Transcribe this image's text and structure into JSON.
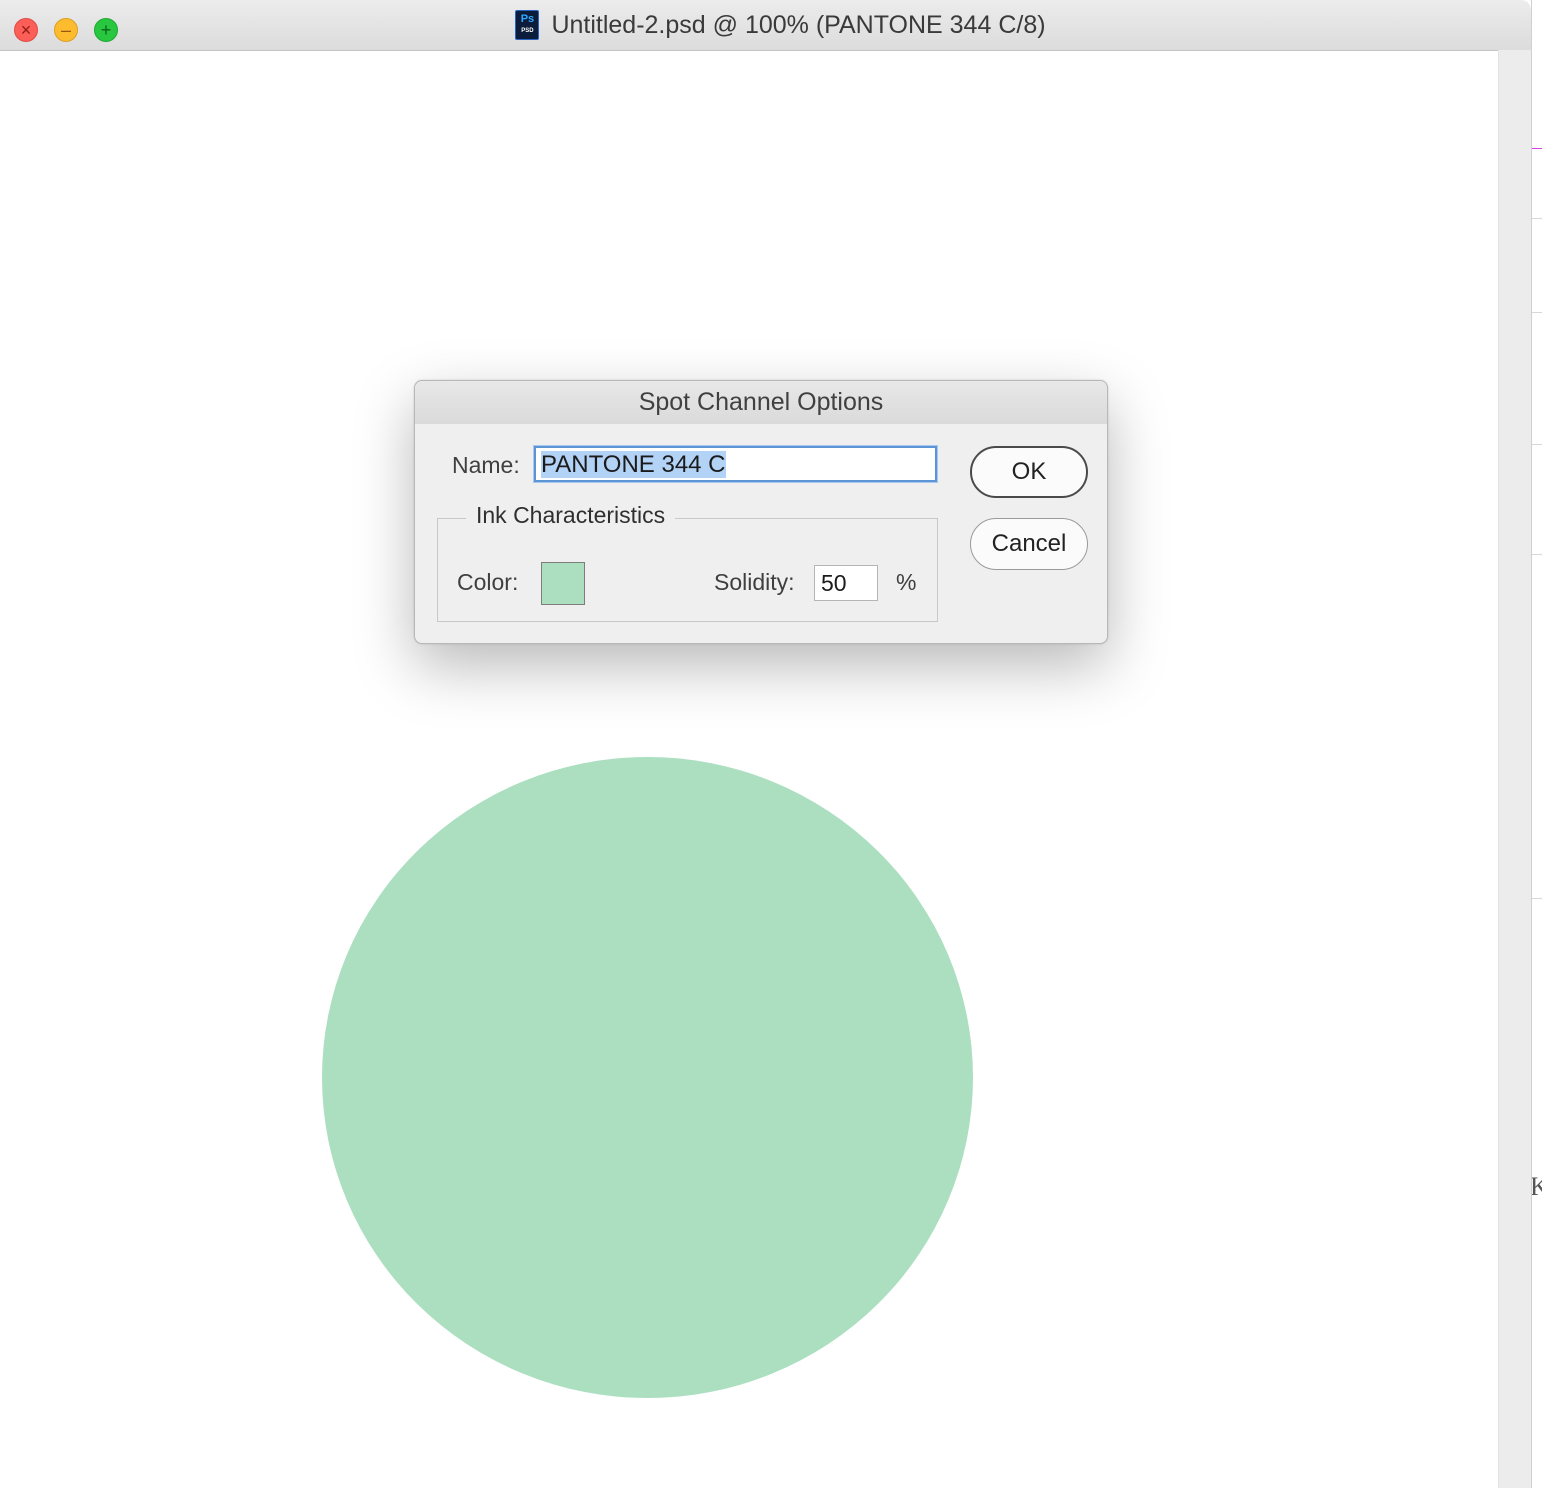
{
  "window": {
    "title": "Untitled-2.psd @ 100% (PANTONE 344 C/8)",
    "doc_icon_text": "Ps",
    "doc_icon_subtext": "PSD",
    "close_glyph": "×",
    "minimize_glyph": "–",
    "maximize_glyph": "+"
  },
  "canvas": {
    "shape_color": "#abdfc0"
  },
  "dialog": {
    "title": "Spot Channel Options",
    "name_label": "Name:",
    "name_value": "PANTONE 344 C",
    "ink_group_label": "Ink Characteristics",
    "color_label": "Color:",
    "ink_color": "#abdfc0",
    "solidity_label": "Solidity:",
    "solidity_value": "50",
    "percent_sign": "%",
    "ok_label": "OK",
    "cancel_label": "Cancel"
  },
  "background_panel": {
    "edge_char_1": "K"
  }
}
